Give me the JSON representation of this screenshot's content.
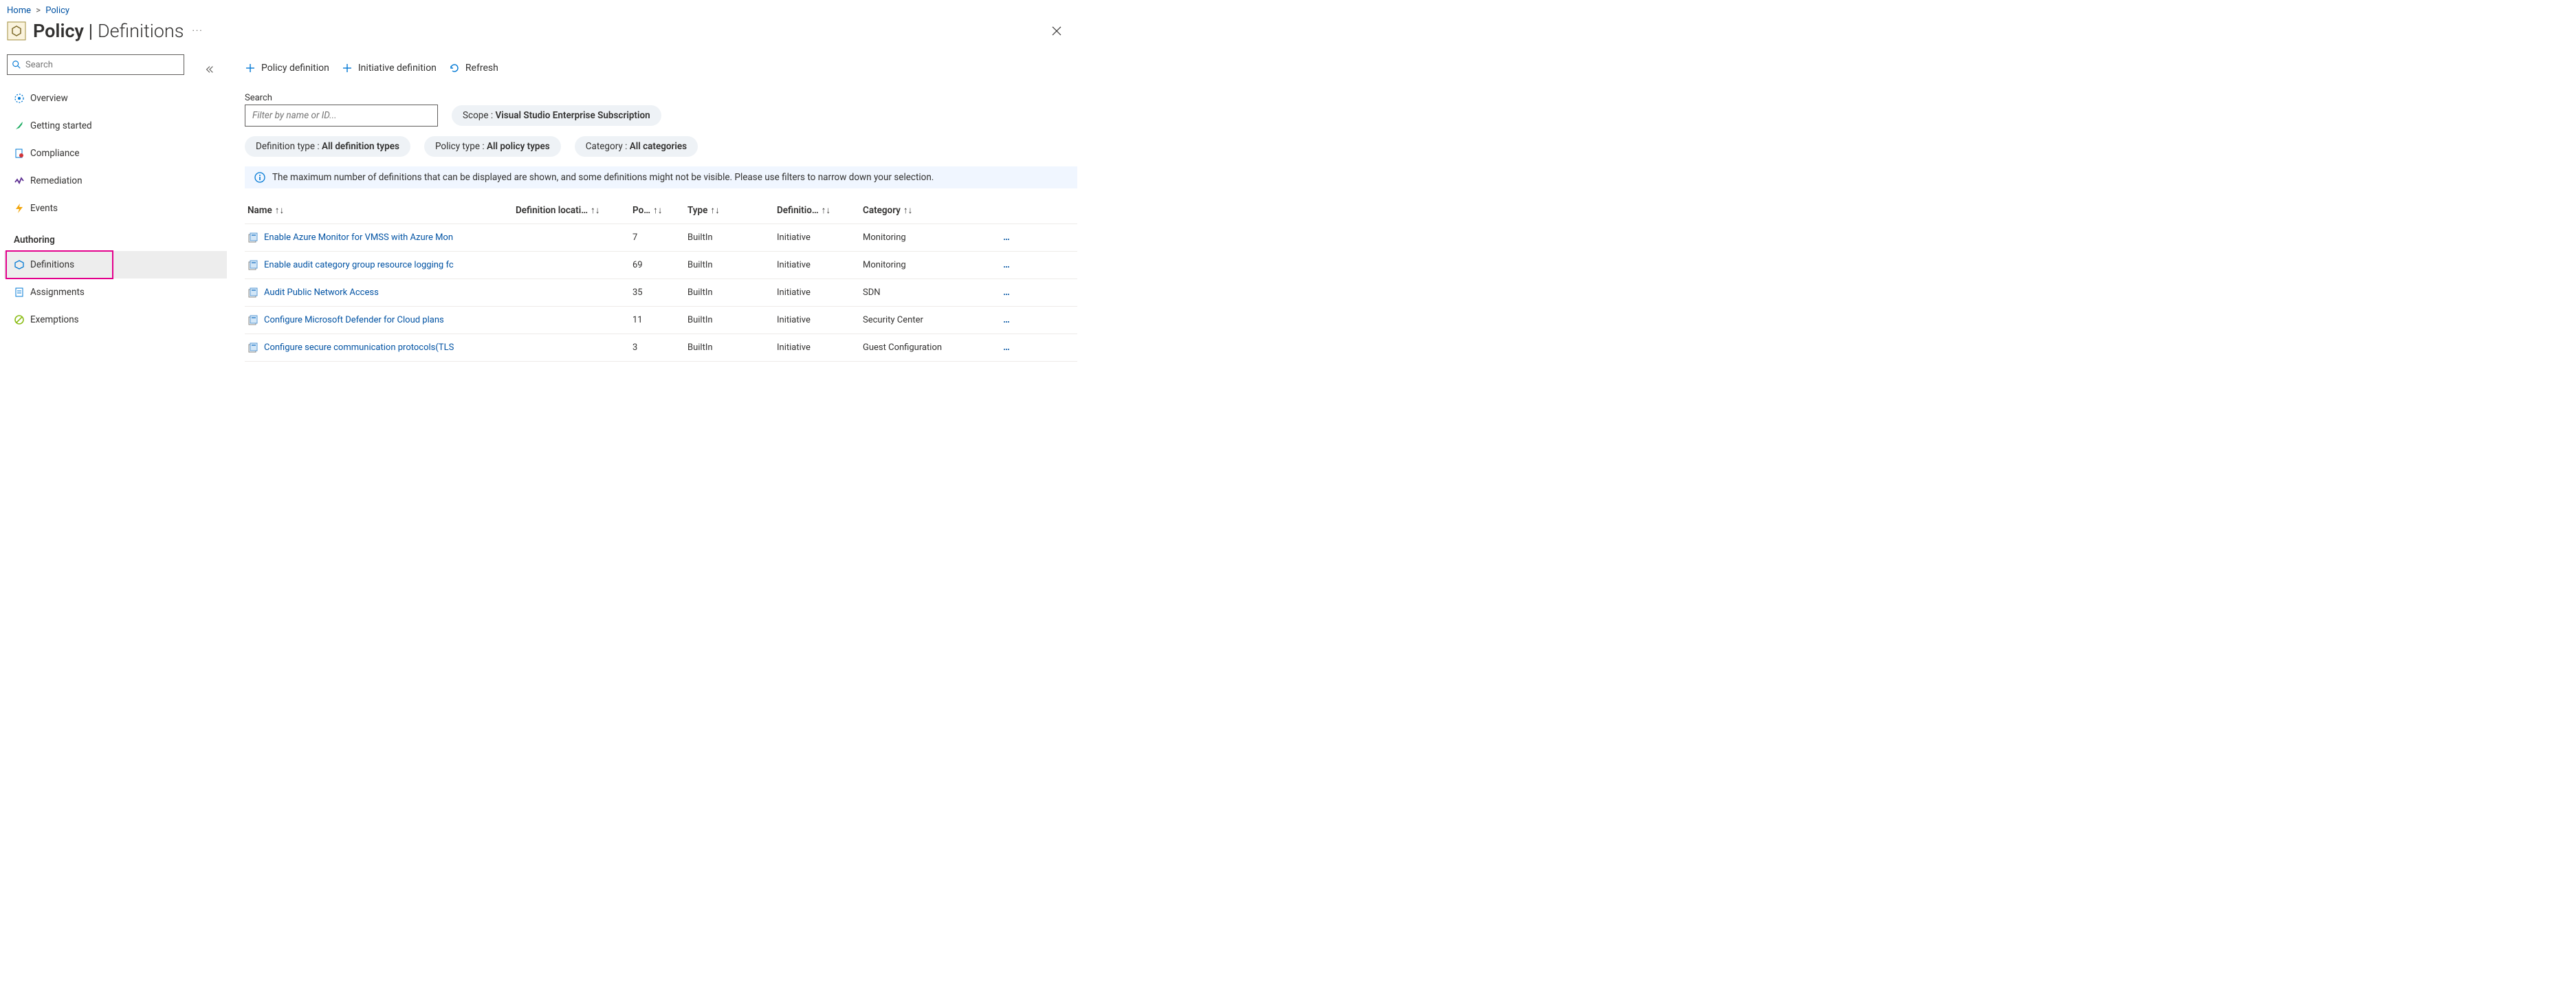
{
  "breadcrumb": {
    "home": "Home",
    "policy": "Policy"
  },
  "header": {
    "title_bold": "Policy",
    "title_sep": " | ",
    "title_thin": "Definitions",
    "more": "···"
  },
  "sidebar": {
    "search_placeholder": "Search",
    "items": [
      {
        "label": "Overview"
      },
      {
        "label": "Getting started"
      },
      {
        "label": "Compliance"
      },
      {
        "label": "Remediation"
      },
      {
        "label": "Events"
      }
    ],
    "group_label": "Authoring",
    "authoring": [
      {
        "label": "Definitions"
      },
      {
        "label": "Assignments"
      },
      {
        "label": "Exemptions"
      }
    ]
  },
  "cmdbar": {
    "policy_def": "Policy definition",
    "initiative_def": "Initiative definition",
    "refresh": "Refresh"
  },
  "filters": {
    "search_label": "Search",
    "search_placeholder": "Filter by name or ID...",
    "scope_label": "Scope : ",
    "scope_value": "Visual Studio Enterprise Subscription",
    "deftype_label": "Definition type : ",
    "deftype_value": "All definition types",
    "poltype_label": "Policy type : ",
    "poltype_value": "All policy types",
    "cat_label": "Category : ",
    "cat_value": "All categories"
  },
  "infobar": {
    "text": "The maximum number of definitions that can be displayed are shown, and some definitions might not be visible. Please use filters to narrow down your selection."
  },
  "columns": {
    "name": "Name",
    "loc": "Definition locati…",
    "po": "Po…",
    "type": "Type",
    "deftype": "Definitio…",
    "category": "Category",
    "sort": "↑↓"
  },
  "rows": [
    {
      "name": "Enable Azure Monitor for VMSS with Azure Mon",
      "po": "7",
      "type": "BuiltIn",
      "deftype": "Initiative",
      "category": "Monitoring"
    },
    {
      "name": "Enable audit category group resource logging fc",
      "po": "69",
      "type": "BuiltIn",
      "deftype": "Initiative",
      "category": "Monitoring"
    },
    {
      "name": "Audit Public Network Access",
      "po": "35",
      "type": "BuiltIn",
      "deftype": "Initiative",
      "category": "SDN"
    },
    {
      "name": "Configure Microsoft Defender for Cloud plans",
      "po": "11",
      "type": "BuiltIn",
      "deftype": "Initiative",
      "category": "Security Center"
    },
    {
      "name": "Configure secure communication protocols(TLS",
      "po": "3",
      "type": "BuiltIn",
      "deftype": "Initiative",
      "category": "Guest Configuration"
    }
  ],
  "row_menu": "…"
}
